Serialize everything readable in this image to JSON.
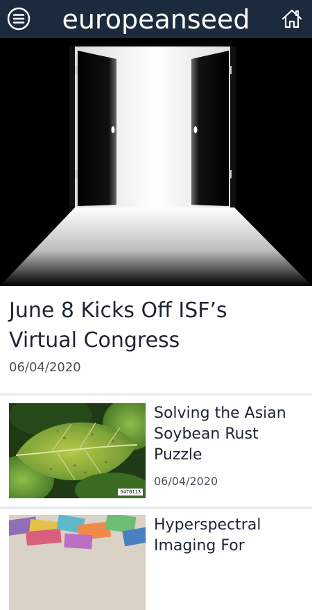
{
  "header": {
    "brand": "europeanseed",
    "menu_icon": "menu-icon",
    "home_icon": "home-icon",
    "background": "#1c2a3d"
  },
  "feature": {
    "title": "June 8 Kicks Off ISF’s Virtual Congress",
    "date": "06/04/2020"
  },
  "articles": [
    {
      "title": "Solving the Asian Soybean Rust Puzzle",
      "date": "06/04/2020",
      "image_badge": "5470113"
    },
    {
      "title": "Hyperspectral Imaging For"
    }
  ]
}
